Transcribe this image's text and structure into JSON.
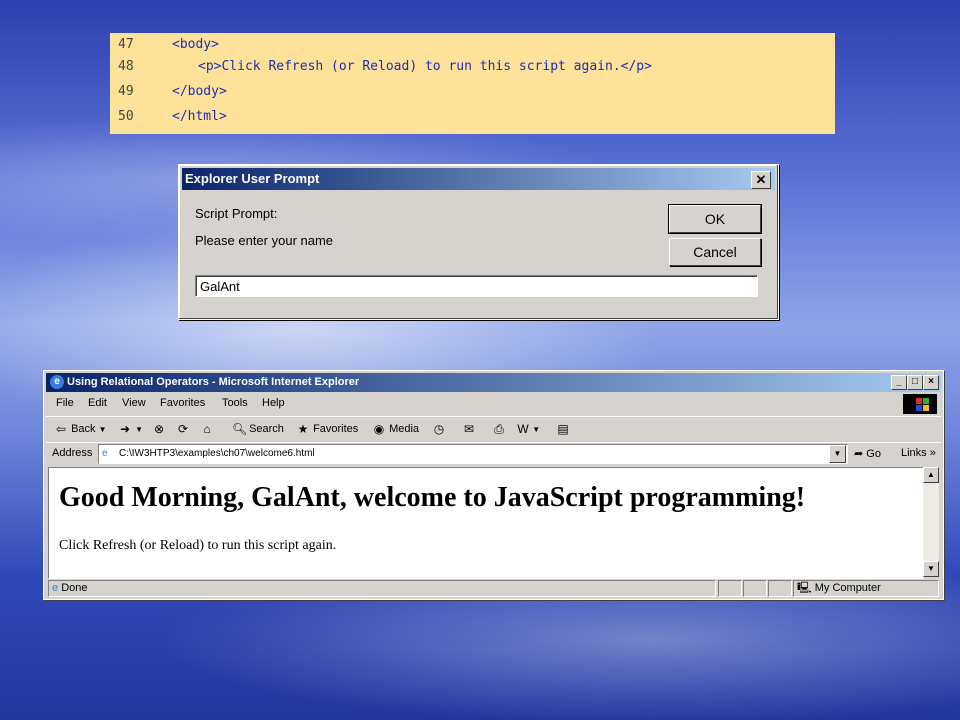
{
  "code": {
    "lines": [
      {
        "num": "47",
        "text": "<body>"
      },
      {
        "num": "48",
        "text": "<p>Click Refresh (or Reload) to run this script again.</p>"
      },
      {
        "num": "49",
        "text": "</body>"
      },
      {
        "num": "50",
        "text": "</html>"
      }
    ]
  },
  "prompt_dialog": {
    "title": "Explorer User Prompt",
    "close_glyph": "✕",
    "script_prompt_label": "Script Prompt:",
    "message": "Please enter your name",
    "ok_label": "OK",
    "cancel_label": "Cancel",
    "input_value": "GalAnt"
  },
  "browser": {
    "title": "Using Relational Operators - Microsoft Internet Explorer",
    "menu": [
      "File",
      "Edit",
      "View",
      "Favorites",
      "Tools",
      "Help"
    ],
    "toolbar": {
      "back": "Back",
      "search": "Search",
      "favorites": "Favorites",
      "media": "Media",
      "go": "Go",
      "links": "Links"
    },
    "address_label": "Address",
    "address_value": "C:\\IW3HTP3\\examples\\ch07\\welcome6.html",
    "heading": "Good Morning, GalAnt, welcome to JavaScript programming!",
    "paragraph": "Click Refresh (or Reload) to run this script again.",
    "status_text": "Done",
    "zone_text": "My Computer"
  },
  "colors": {
    "code_bg": "#ffe29a",
    "code_text": "#1a2fb0",
    "title_bar_start": "#0a246a",
    "title_bar_end": "#a6caf0",
    "chrome": "#d6d3ce"
  }
}
